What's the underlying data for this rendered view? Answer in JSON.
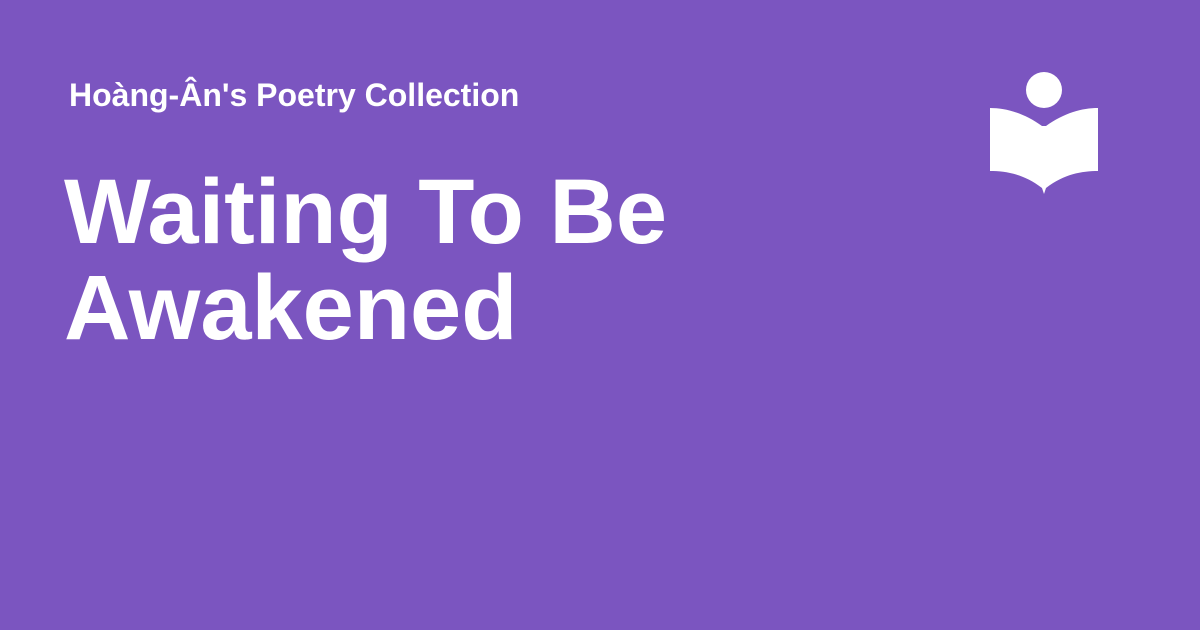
{
  "header": {
    "collection_label": "Hoàng-Ân's Poetry Collection"
  },
  "main": {
    "title": "Waiting To Be Awakened"
  },
  "logo": {
    "icon": "reader-book-icon"
  },
  "colors": {
    "background": "#7b55c0",
    "text": "#ffffff"
  }
}
